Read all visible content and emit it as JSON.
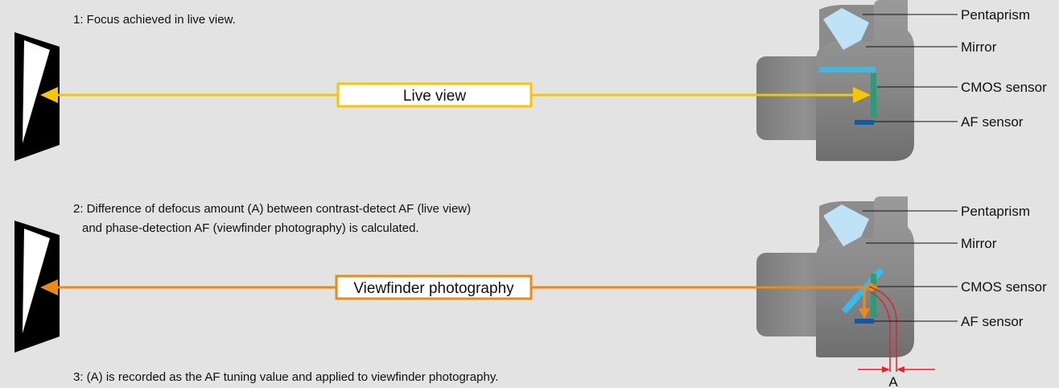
{
  "panel1": {
    "caption": "1: Focus achieved in live view.",
    "ray_label": "Live view",
    "labels": {
      "pentaprism": "Pentaprism",
      "mirror": "Mirror",
      "cmos": "CMOS sensor",
      "af": "AF sensor"
    }
  },
  "panel2": {
    "caption_line1": "2: Difference of defocus amount (A) between contrast-detect AF (live view)",
    "caption_line2": "and phase-detection AF (viewfinder photography) is calculated.",
    "ray_label": "Viewfinder photography",
    "labels": {
      "pentaprism": "Pentaprism",
      "mirror": "Mirror",
      "cmos": "CMOS sensor",
      "af": "AF sensor"
    },
    "dimension_label": "A"
  },
  "panel3": {
    "caption": "3: (A) is recorded as the AF tuning value and applied to viewfinder photography."
  },
  "colors": {
    "live_view_ray": "#f6c600",
    "viewfinder_ray": "#ee8a12",
    "camera_body": "#878787",
    "pentaprism": "#bfe2f6",
    "mirror": "#39b8ec",
    "cmos_sensor": "#2f9a78",
    "af_sensor": "#1458a8",
    "dimension": "#e8212a"
  }
}
